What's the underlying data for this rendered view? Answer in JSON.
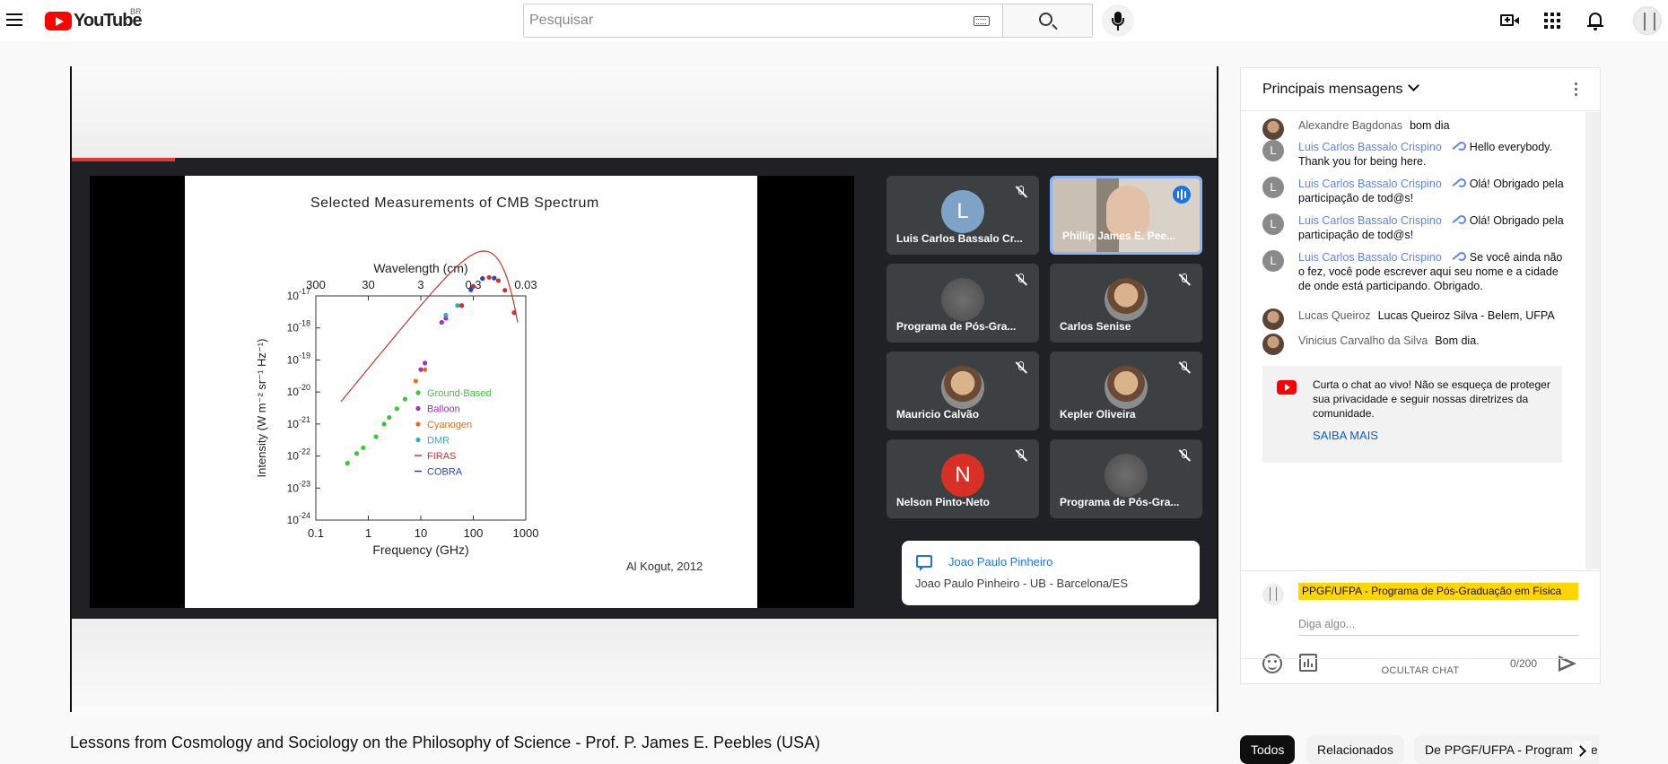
{
  "header": {
    "logo_text": "YouTube",
    "country": "BR",
    "search_placeholder": "Pesquisar"
  },
  "video": {
    "title": "Lessons from Cosmology and Sociology on the Philosophy of Science - Prof. P. James E. Peebles (USA)",
    "slide": {
      "title": "Selected Measurements of CMB Spectrum",
      "credit": "Al Kogut, 2012"
    },
    "participants": [
      {
        "name": "Luis Carlos Bassalo Cr...",
        "avatar": "L",
        "avatar_color": "#7fa3c7",
        "kind": "letter",
        "muted": true
      },
      {
        "name": "Phillip James E. Pee...",
        "kind": "video",
        "speaking": true
      },
      {
        "name": "Programa de Pós-Gra...",
        "kind": "blur",
        "muted": true
      },
      {
        "name": "Carlos Senise",
        "kind": "photo",
        "muted": true
      },
      {
        "name": "Mauricio Calvão",
        "kind": "photo",
        "muted": true
      },
      {
        "name": "Kepler Oliveira",
        "kind": "photo",
        "muted": true
      },
      {
        "name": "Nelson Pinto-Neto",
        "avatar": "N",
        "avatar_color": "#d93025",
        "kind": "letter",
        "muted": true
      },
      {
        "name": "Programa de Pós-Gra...",
        "kind": "blur",
        "muted": true
      }
    ],
    "meet_chat_popup": {
      "name": "Joao Paulo Pinheiro",
      "message": "Joao Paulo Pinheiro - UB - Barcelona/ES"
    }
  },
  "chart_data": {
    "type": "scatter",
    "title": "Selected Measurements of CMB Spectrum",
    "xlabel": "Frequency (GHz)",
    "ylabel": "Intensity (W m⁻² sr⁻¹ Hz⁻¹)",
    "top_axis_label": "Wavelength (cm)",
    "x_scale": "log",
    "y_scale": "log",
    "xlim": [
      0.1,
      1000
    ],
    "ylim": [
      1e-24,
      1e-17
    ],
    "x_ticks": [
      "0.1",
      "1",
      "10",
      "100",
      "1000"
    ],
    "top_ticks": [
      "300",
      "30",
      "3",
      "0.3",
      "0.03"
    ],
    "y_ticks": [
      "10-24",
      "10-23",
      "10-22",
      "10-21",
      "10-20",
      "10-19",
      "10-18",
      "10-17"
    ],
    "legend_position": "center",
    "series": [
      {
        "name": "Ground-Based",
        "color": "#37c837",
        "x": [
          0.4,
          0.6,
          0.8,
          1.4,
          2.0,
          2.5,
          3.5,
          5.0
        ],
        "y": [
          6e-23,
          1.2e-22,
          1.8e-22,
          4e-22,
          1e-21,
          1.6e-21,
          3e-21,
          6e-21
        ]
      },
      {
        "name": "Balloon",
        "color": "#a030c0",
        "x": [
          10,
          12,
          25,
          30,
          60
        ],
        "y": [
          5e-20,
          8e-20,
          1.5e-18,
          2e-18,
          5e-18
        ]
      },
      {
        "name": "Cyanogen",
        "color": "#e07020",
        "x": [
          8,
          12
        ],
        "y": [
          2.2e-20,
          5e-20
        ]
      },
      {
        "name": "DMR",
        "color": "#30b0b0",
        "x": [
          30,
          50,
          90
        ],
        "y": [
          2.5e-18,
          5e-18,
          1.5e-17
        ]
      },
      {
        "name": "FIRAS",
        "color": "#d03030",
        "x": [
          60,
          100,
          150,
          200,
          300,
          400,
          600
        ],
        "y": [
          5e-18,
          2e-17,
          3.5e-17,
          3.8e-17,
          3e-17,
          1.5e-17,
          3e-18
        ]
      },
      {
        "name": "COBRA",
        "color": "#3040c0",
        "x": [
          90,
          150,
          250
        ],
        "y": [
          1.6e-17,
          3.5e-17,
          3.6e-17
        ]
      }
    ]
  },
  "chat": {
    "header_title": "Principais mensagens",
    "messages": [
      {
        "author": "Alexandre Bagdonas",
        "text": "bom dia",
        "owner": false,
        "avatar": ""
      },
      {
        "author": "Luis Carlos Bassalo Crispino",
        "text": "Hello everybody. Thank you for being here.",
        "owner": true,
        "avatar": "L"
      },
      {
        "author": "Luis Carlos Bassalo Crispino",
        "text": "Olá! Obrigado pela participação de tod@s!",
        "owner": true,
        "avatar": "L"
      },
      {
        "author": "Luis Carlos Bassalo Crispino",
        "text": "Olá! Obrigado pela participação de tod@s!",
        "owner": true,
        "avatar": "L"
      },
      {
        "author": "Luis Carlos Bassalo Crispino",
        "text": "Se você ainda não o fez, você pode escrever aqui seu nome e a cidade de onde está participando. Obrigado.",
        "owner": true,
        "avatar": "L"
      },
      {
        "author": "Lucas Queiroz",
        "text": "Lucas Queiroz Silva - Belem, UFPA",
        "owner": false,
        "avatar": ""
      },
      {
        "author": "Vinicius Carvalho da Silva",
        "text": "Bom dia.",
        "owner": false,
        "avatar": ""
      }
    ],
    "notice": {
      "text": "Curta o chat ao vivo! Não se esqueça de proteger sua privacidade e seguir nossas diretrizes da comunidade.",
      "link": "SAIBA MAIS"
    },
    "compose": {
      "user_name": "PPGF/UFPA - Programa de Pós-Graduação em Física",
      "placeholder": "Diga algo...",
      "counter": "0/200"
    },
    "hide_label": "OCULTAR CHAT"
  },
  "chips": [
    "Todos",
    "Relacionados",
    "De PPGF/UFPA - Programa de Pós-Graduação em Física"
  ]
}
